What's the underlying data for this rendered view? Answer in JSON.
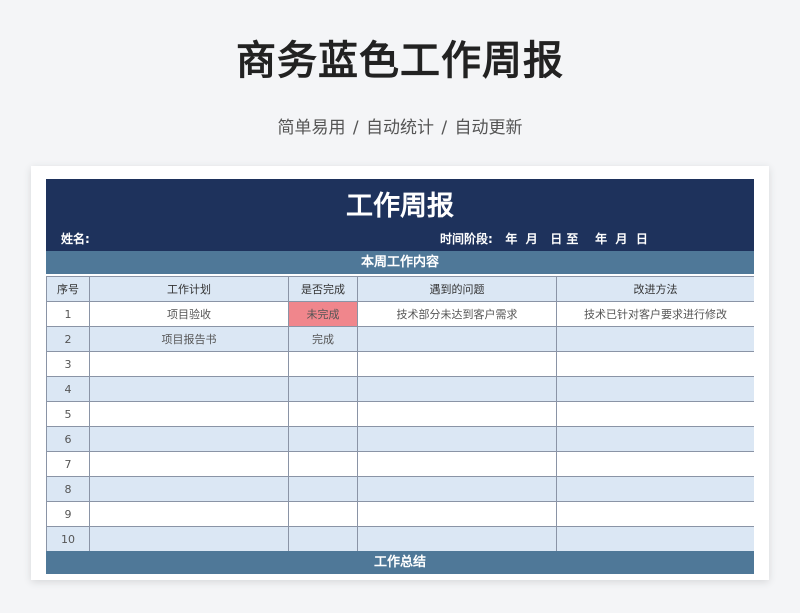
{
  "hero": {
    "title": "商务蓝色工作周报",
    "subtitle": "简单易用 / 自动统计 / 自动更新"
  },
  "report": {
    "title": "工作周报",
    "name_label": "姓名:",
    "period_text": "时间阶段:   年  月   日 至    年  月  日",
    "section_this_week": "本周工作内容",
    "section_summary": "工作总结"
  },
  "table": {
    "headers": [
      "序号",
      "工作计划",
      "是否完成",
      "遇到的问题",
      "改进方法"
    ],
    "rows": [
      {
        "no": "1",
        "plan": "项目验收",
        "done": "未完成",
        "problem": "技术部分未达到客户需求",
        "improve": "技术已针对客户要求进行修改"
      },
      {
        "no": "2",
        "plan": "项目报告书",
        "done": "完成",
        "problem": "",
        "improve": ""
      },
      {
        "no": "3",
        "plan": "",
        "done": "",
        "problem": "",
        "improve": ""
      },
      {
        "no": "4",
        "plan": "",
        "done": "",
        "problem": "",
        "improve": ""
      },
      {
        "no": "5",
        "plan": "",
        "done": "",
        "problem": "",
        "improve": ""
      },
      {
        "no": "6",
        "plan": "",
        "done": "",
        "problem": "",
        "improve": ""
      },
      {
        "no": "7",
        "plan": "",
        "done": "",
        "problem": "",
        "improve": ""
      },
      {
        "no": "8",
        "plan": "",
        "done": "",
        "problem": "",
        "improve": ""
      },
      {
        "no": "9",
        "plan": "",
        "done": "",
        "problem": "",
        "improve": ""
      },
      {
        "no": "10",
        "plan": "",
        "done": "",
        "problem": "",
        "improve": ""
      }
    ]
  },
  "colors": {
    "header_navy": "#1e325c",
    "band_steel": "#4f7898",
    "row_tint": "#dbe7f4",
    "status_incomplete": "#f0868c"
  }
}
